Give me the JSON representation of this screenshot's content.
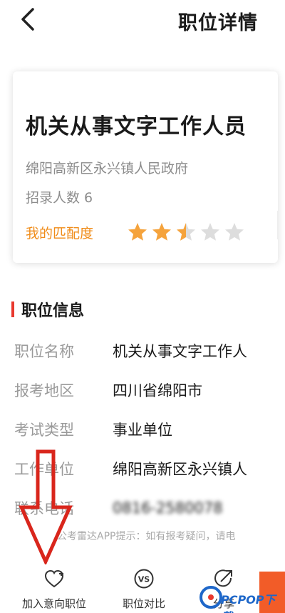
{
  "nav": {
    "title": "职位详情"
  },
  "card": {
    "job_title": "机关从事文字工作人员",
    "organization": "绵阳高新区永兴镇人民政府",
    "headcount": "招录人数 6",
    "match_label": "我的匹配度",
    "match_rating": {
      "value": 2.5,
      "max": 5
    }
  },
  "section": {
    "title": "职位信息"
  },
  "info_rows": [
    {
      "label": "职位名称",
      "value": "机关从事文字工作人"
    },
    {
      "label": "报考地区",
      "value": "四川省绵阳市"
    },
    {
      "label": "考试类型",
      "value": "事业单位"
    },
    {
      "label": "工作单位",
      "value": "绵阳高新区永兴镇人"
    },
    {
      "label": "联系电话",
      "value": "0816-2580078"
    }
  ],
  "tip": "公考雷达APP提示：如有报考疑问，请电",
  "bottom_bar": {
    "favorite": "加入意向职位",
    "compare": "职位对比",
    "share": "分享"
  },
  "watermark": "PCPOP下载",
  "colors": {
    "accent_orange": "#f08c19",
    "star_orange": "#f5a33c",
    "star_gray": "#dddddd",
    "section_bar_red": "#e8382e",
    "arrow_red": "#d9261c",
    "apply_button": "#f25c28"
  },
  "icons": {
    "back": "chevron-left-icon",
    "favorite": "heart-plus-icon",
    "compare": "vs-circle-icon",
    "share": "share-arrow-icon"
  }
}
